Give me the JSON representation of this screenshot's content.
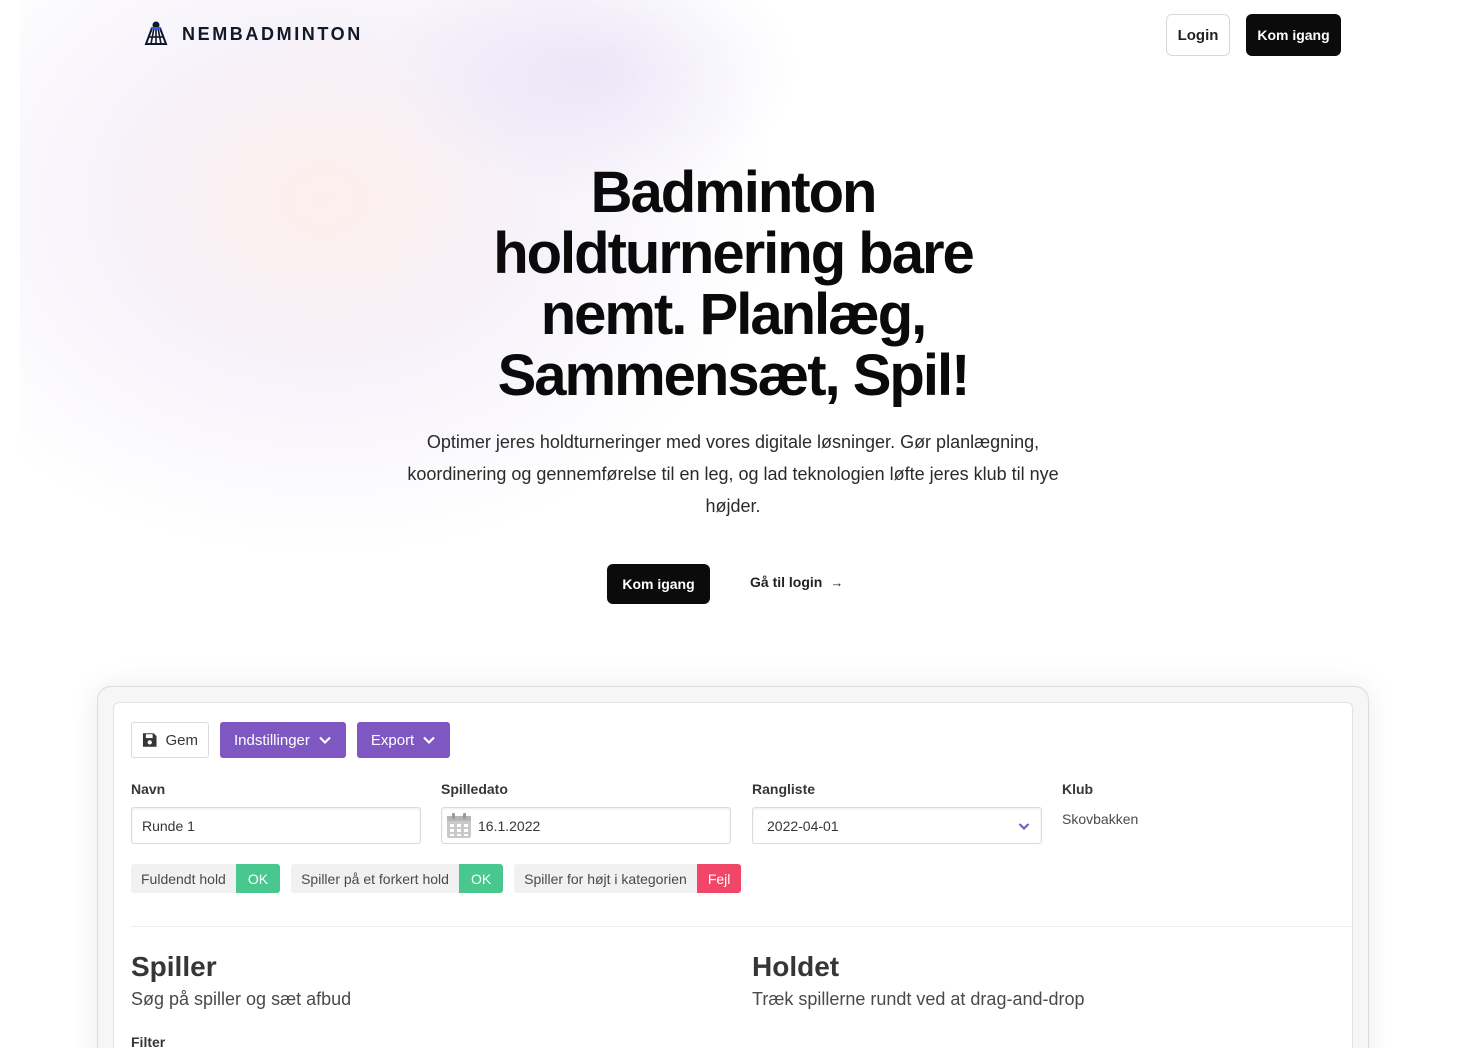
{
  "nav": {
    "brand": "NEMBADMINTON",
    "login": "Login",
    "start": "Kom igang"
  },
  "hero": {
    "title": "Badminton holdturnering bare nemt. Planlæg, Sammensæt, Spil!",
    "subtitle": "Optimer jeres holdturneringer med vores digitale løsninger. Gør planlægning, koordinering og gennemførelse til en leg, og lad teknologien løfte jeres klub til nye højder.",
    "cta_primary": "Kom igang",
    "cta_secondary": "Gå til login",
    "cta_secondary_arrow": "→"
  },
  "app": {
    "toolbar": {
      "save": "Gem",
      "settings": "Indstillinger",
      "export": "Export"
    },
    "fields": {
      "name_label": "Navn",
      "name_value": "Runde 1",
      "date_label": "Spilledato",
      "date_value": "16.1.2022",
      "ranking_label": "Rangliste",
      "ranking_value": "2022-04-01",
      "club_label": "Klub",
      "club_value": "Skovbakken"
    },
    "checks": [
      {
        "name": "Fuldendt hold",
        "status": "OK"
      },
      {
        "name": "Spiller på et forkert hold",
        "status": "OK"
      },
      {
        "name": "Spiller for højt i kategorien",
        "status": "Fejl"
      }
    ],
    "players": {
      "title": "Spiller",
      "subtitle": "Søg på spiller og sæt afbud",
      "filter_label": "Filter"
    },
    "team": {
      "title": "Holdet",
      "subtitle": "Træk spillerne rundt ved at drag-and-drop"
    }
  },
  "colors": {
    "accent_purple": "#7e57c2",
    "ok_green": "#48c78e",
    "error_red": "#f14668",
    "dark_button": "#0b0b0b"
  }
}
